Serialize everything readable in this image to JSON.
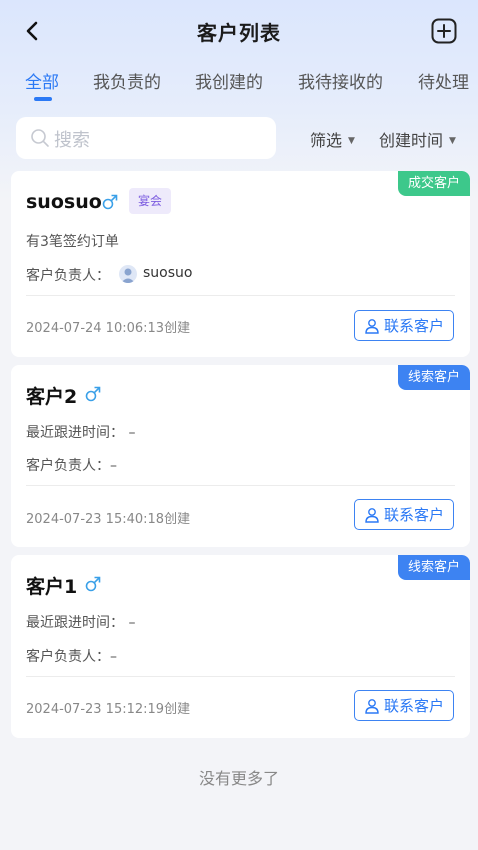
{
  "header": {
    "title": "客户列表"
  },
  "tabs": [
    {
      "label": "全部",
      "active": true
    },
    {
      "label": "我负责的",
      "active": false
    },
    {
      "label": "我创建的",
      "active": false
    },
    {
      "label": "我待接收的",
      "active": false
    },
    {
      "label": "待处理",
      "active": false
    }
  ],
  "search": {
    "placeholder": "搜索"
  },
  "filters": {
    "filter_label": "筛选",
    "sort_label": "创建时间"
  },
  "customers": [
    {
      "name": "suosuo",
      "tag": "宴会",
      "status": "成交客户",
      "status_color": "#3dc88b",
      "info_line": "有3笔签约订单",
      "owner_label": "客户负责人：",
      "owner_name": "suosuo",
      "created": "2024-07-24 10:06:13创建",
      "contact_label": "联系客户"
    },
    {
      "name": "客户2",
      "status": "线索客户",
      "status_color": "#3d83f2",
      "info_line": "最近跟进时间：  –",
      "owner_label": "客户负责人：–",
      "created": "2024-07-23 15:40:18创建",
      "contact_label": "联系客户"
    },
    {
      "name": "客户1",
      "status": "线索客户",
      "status_color": "#3d83f2",
      "info_line": "最近跟进时间：  –",
      "owner_label": "客户负责人：–",
      "created": "2024-07-23 15:12:19创建",
      "contact_label": "联系客户"
    }
  ],
  "footer": {
    "no_more": "没有更多了"
  },
  "colors": {
    "accent": "#2b79f5",
    "male_icon": "#3aa0e8",
    "tag_text": "#7c5ce0"
  }
}
